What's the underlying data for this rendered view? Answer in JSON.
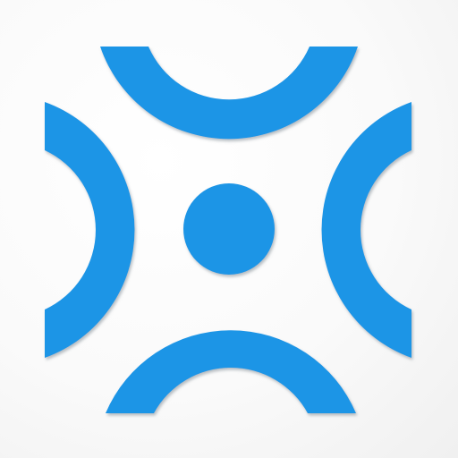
{
  "app_icon": {
    "icon_name": "expand-arcs-dot-icon",
    "colors": {
      "primary": "#1E95E6",
      "shadow": "#9AA3AA",
      "background": "#FFFFFF"
    }
  }
}
